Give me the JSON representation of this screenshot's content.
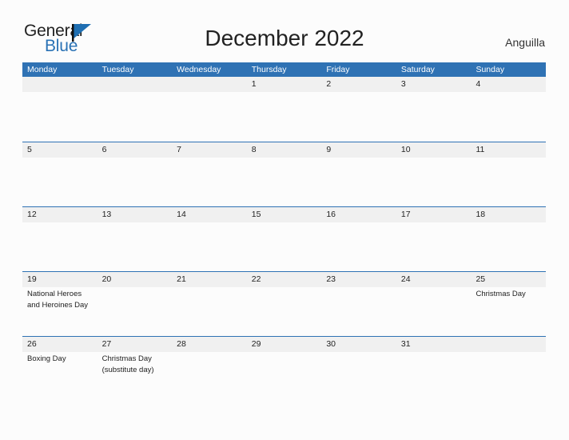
{
  "brand": {
    "name_part1": "General",
    "name_part2": "Blue",
    "flag_icon": "triangle-flag-icon",
    "accent_color": "#2a72b5"
  },
  "header": {
    "title": "December 2022",
    "country": "Anguilla"
  },
  "colors": {
    "header_blue": "#2f72b4",
    "row_stripe": "#f0f0f0",
    "page_background": "#fcfcfc",
    "text": "#222222"
  },
  "calendar": {
    "weekdays": [
      "Monday",
      "Tuesday",
      "Wednesday",
      "Thursday",
      "Friday",
      "Saturday",
      "Sunday"
    ],
    "weeks": [
      [
        {
          "day": "",
          "events": []
        },
        {
          "day": "",
          "events": []
        },
        {
          "day": "",
          "events": []
        },
        {
          "day": "1",
          "events": []
        },
        {
          "day": "2",
          "events": []
        },
        {
          "day": "3",
          "events": []
        },
        {
          "day": "4",
          "events": []
        }
      ],
      [
        {
          "day": "5",
          "events": []
        },
        {
          "day": "6",
          "events": []
        },
        {
          "day": "7",
          "events": []
        },
        {
          "day": "8",
          "events": []
        },
        {
          "day": "9",
          "events": []
        },
        {
          "day": "10",
          "events": []
        },
        {
          "day": "11",
          "events": []
        }
      ],
      [
        {
          "day": "12",
          "events": []
        },
        {
          "day": "13",
          "events": []
        },
        {
          "day": "14",
          "events": []
        },
        {
          "day": "15",
          "events": []
        },
        {
          "day": "16",
          "events": []
        },
        {
          "day": "17",
          "events": []
        },
        {
          "day": "18",
          "events": []
        }
      ],
      [
        {
          "day": "19",
          "events": [
            "National Heroes\nand Heroines Day"
          ]
        },
        {
          "day": "20",
          "events": []
        },
        {
          "day": "21",
          "events": []
        },
        {
          "day": "22",
          "events": []
        },
        {
          "day": "23",
          "events": []
        },
        {
          "day": "24",
          "events": []
        },
        {
          "day": "25",
          "events": [
            "Christmas Day"
          ]
        }
      ],
      [
        {
          "day": "26",
          "events": [
            "Boxing Day"
          ]
        },
        {
          "day": "27",
          "events": [
            "Christmas Day\n(substitute day)"
          ]
        },
        {
          "day": "28",
          "events": []
        },
        {
          "day": "29",
          "events": []
        },
        {
          "day": "30",
          "events": []
        },
        {
          "day": "31",
          "events": []
        },
        {
          "day": "",
          "events": []
        }
      ]
    ]
  }
}
